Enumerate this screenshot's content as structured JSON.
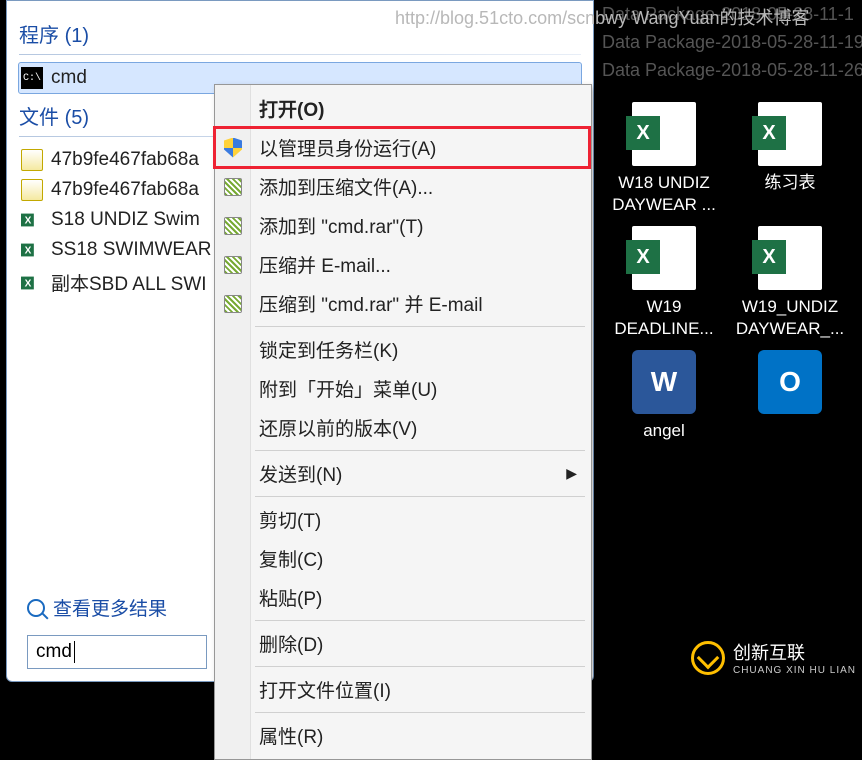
{
  "watermark": "http://blog.51cto.com/scnbwy WangYuan的技术博客",
  "start_menu": {
    "programs_header": "程序",
    "programs_count": "(1)",
    "programs": [
      {
        "label": "cmd",
        "icon": "cmd-icon"
      }
    ],
    "files_header": "文件",
    "files_count": "(5)",
    "files": [
      {
        "label": "47b9fe467fab68a",
        "icon": "script-icon"
      },
      {
        "label": "47b9fe467fab68a",
        "icon": "script-icon"
      },
      {
        "label": "S18 UNDIZ Swim",
        "icon": "excel-icon"
      },
      {
        "label": "SS18 SWIMWEAR",
        "icon": "excel-icon"
      },
      {
        "label": "副本SBD ALL SWI",
        "icon": "excel-icon"
      }
    ],
    "see_more": "查看更多结果",
    "search_value": "cmd"
  },
  "context_menu": {
    "items": [
      {
        "label": "打开(O)",
        "bold": true,
        "icon": null
      },
      {
        "label": "以管理员身份运行(A)",
        "icon": "shield-icon",
        "highlight": true
      },
      {
        "label": "添加到压缩文件(A)...",
        "icon": "rar-icon"
      },
      {
        "label": "添加到 \"cmd.rar\"(T)",
        "icon": "rar-icon"
      },
      {
        "label": "压缩并 E-mail...",
        "icon": "rar-icon"
      },
      {
        "label": "压缩到 \"cmd.rar\" 并 E-mail",
        "icon": "rar-icon"
      },
      {
        "sep": true
      },
      {
        "label": "锁定到任务栏(K)"
      },
      {
        "label": "附到「开始」菜单(U)"
      },
      {
        "label": "还原以前的版本(V)"
      },
      {
        "sep": true
      },
      {
        "label": "发送到(N)",
        "submenu": true
      },
      {
        "sep": true
      },
      {
        "label": "剪切(T)"
      },
      {
        "label": "复制(C)"
      },
      {
        "label": "粘贴(P)"
      },
      {
        "sep": true
      },
      {
        "label": "删除(D)"
      },
      {
        "sep": true
      },
      {
        "label": "打开文件位置(I)"
      },
      {
        "sep": true
      },
      {
        "label": "属性(R)"
      }
    ]
  },
  "desktop": {
    "bg_lines": [
      "Data Package-2018-05-28-11-1",
      "Data Package-2018-05-28-11-19",
      "Data Package-2018-05-28-11-26"
    ],
    "icons": [
      {
        "label": "W18 UNDIZ DAYWEAR ...",
        "type": "excel"
      },
      {
        "label": "练习表",
        "type": "excel"
      },
      {
        "label": "W19 DEADLINE...",
        "type": "excel"
      },
      {
        "label": "W19_UNDIZ DAYWEAR_...",
        "type": "excel"
      },
      {
        "label": "angel",
        "type": "word"
      },
      {
        "label": "",
        "type": "outlook"
      }
    ]
  },
  "brand": {
    "name": "创新互联",
    "sub": "CHUANG XIN HU LIAN"
  }
}
